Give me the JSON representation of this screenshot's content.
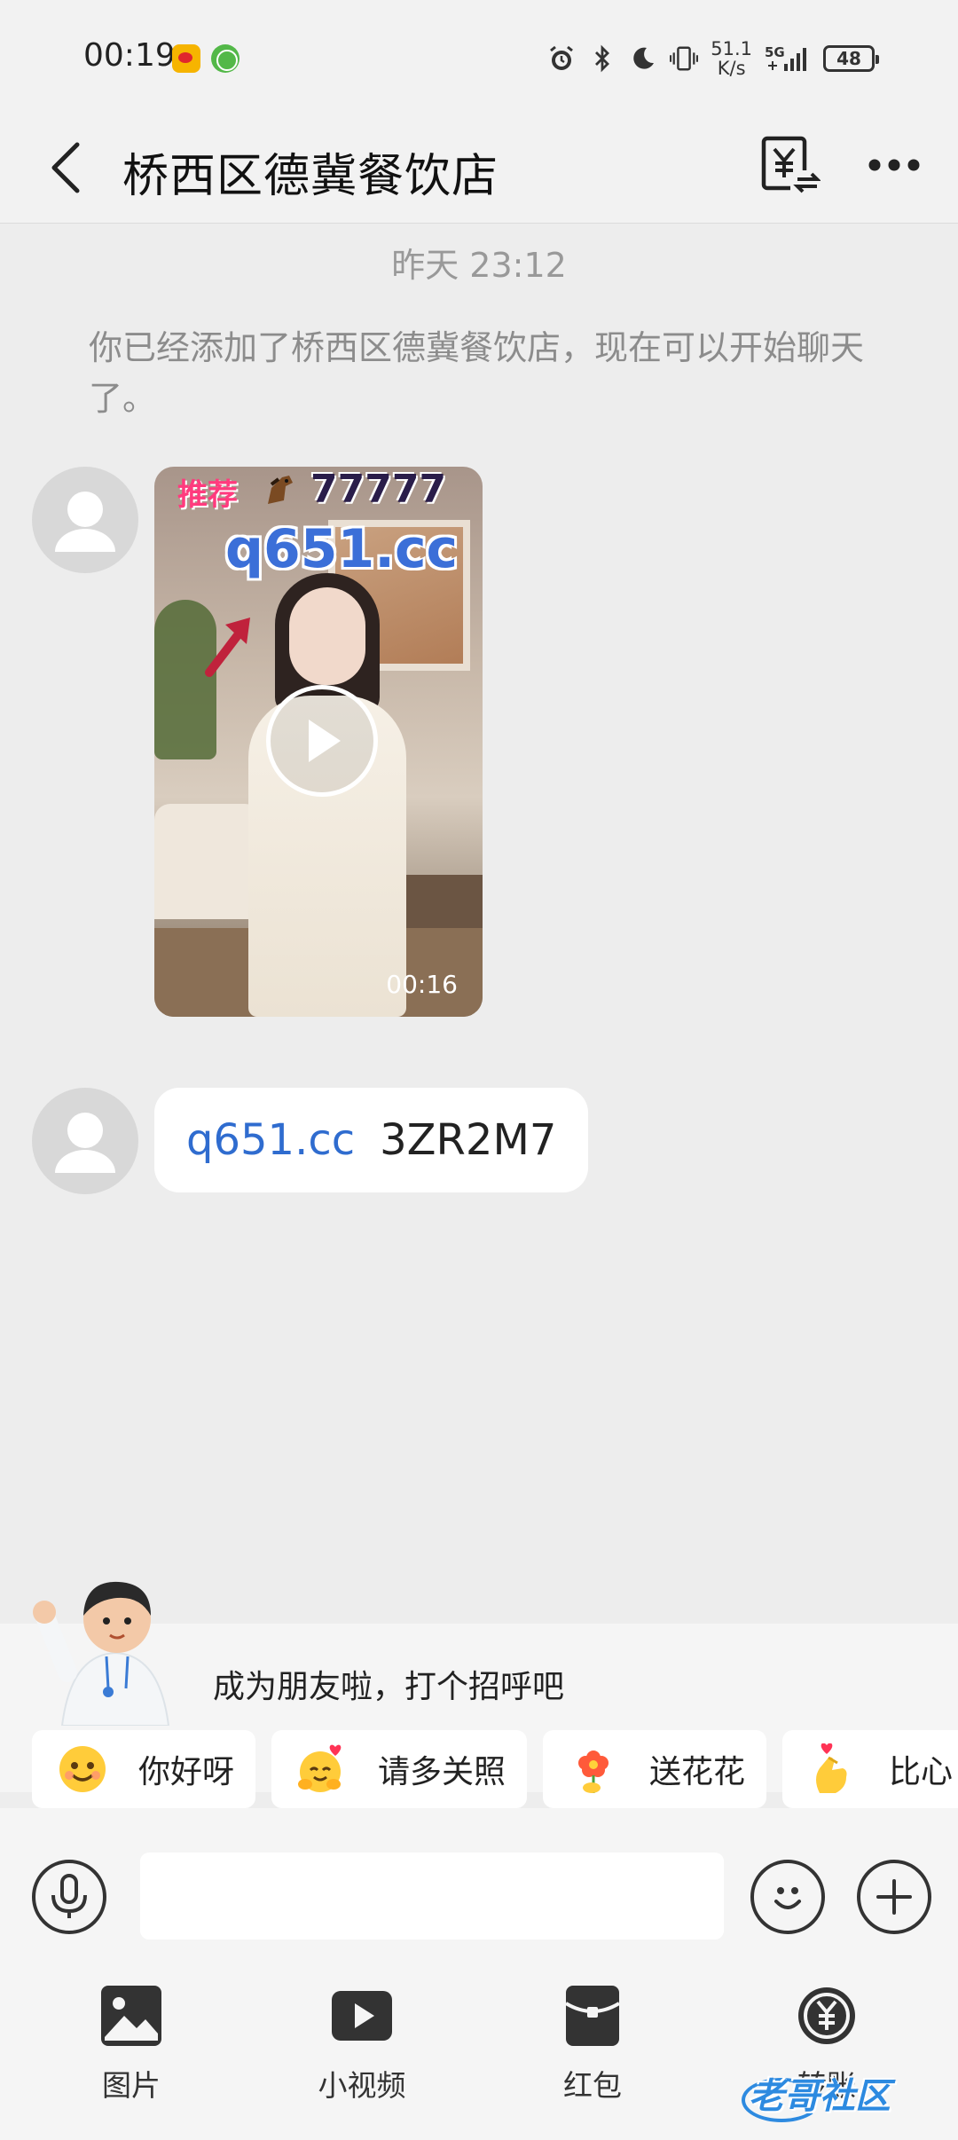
{
  "status_bar": {
    "time": "00:19",
    "network_speed_value": "51.1",
    "network_speed_unit": "K/s",
    "signal_label": "5G",
    "battery": "48",
    "app_icons": [
      "weibo-icon",
      "pdf-app-icon"
    ],
    "system_icons": [
      "alarm-icon",
      "bluetooth-icon",
      "do-not-disturb-moon-icon",
      "vibrate-icon",
      "signal-icon",
      "battery-icon"
    ]
  },
  "header": {
    "title": "桥西区德冀餐饮店",
    "back_icon": "back-arrow-icon",
    "transfer_icon": "yuan-transfer-icon",
    "more_icon": "more-dots-icon"
  },
  "conversation": {
    "timestamp": "昨天 23:12",
    "system_message": "你已经添加了桥西区德冀餐饮店，现在可以开始聊天了。",
    "video_message": {
      "overlay_tag": "推荐",
      "overlay_number": "77777",
      "overlay_url": "q651.cc",
      "duration": "00:16"
    },
    "text_message": {
      "link": "q651.cc",
      "code": "3ZR2M7"
    }
  },
  "greeting": {
    "prompt": "成为朋友啦，打个招呼吧",
    "chips": [
      {
        "label": "你好呀",
        "icon": "smiling-face-emoji-icon"
      },
      {
        "label": "请多关照",
        "icon": "hugging-face-emoji-icon"
      },
      {
        "label": "送花花",
        "icon": "flower-emoji-icon"
      },
      {
        "label": "比心",
        "icon": "finger-heart-emoji-icon"
      }
    ]
  },
  "input_bar": {
    "placeholder": "",
    "voice_icon": "microphone-icon",
    "emoji_icon": "smiley-icon",
    "plus_icon": "plus-icon"
  },
  "toolbar": {
    "items": [
      {
        "label": "图片",
        "icon": "image-icon"
      },
      {
        "label": "小视频",
        "icon": "video-icon"
      },
      {
        "label": "红包",
        "icon": "red-packet-icon"
      },
      {
        "label": "转账",
        "icon": "transfer-icon"
      }
    ]
  },
  "watermark": {
    "text": "老哥社区"
  },
  "colors": {
    "background": "#ededed",
    "link": "#2f6ccf",
    "bubble": "#ffffff",
    "muted_text": "#8c8c8c"
  }
}
